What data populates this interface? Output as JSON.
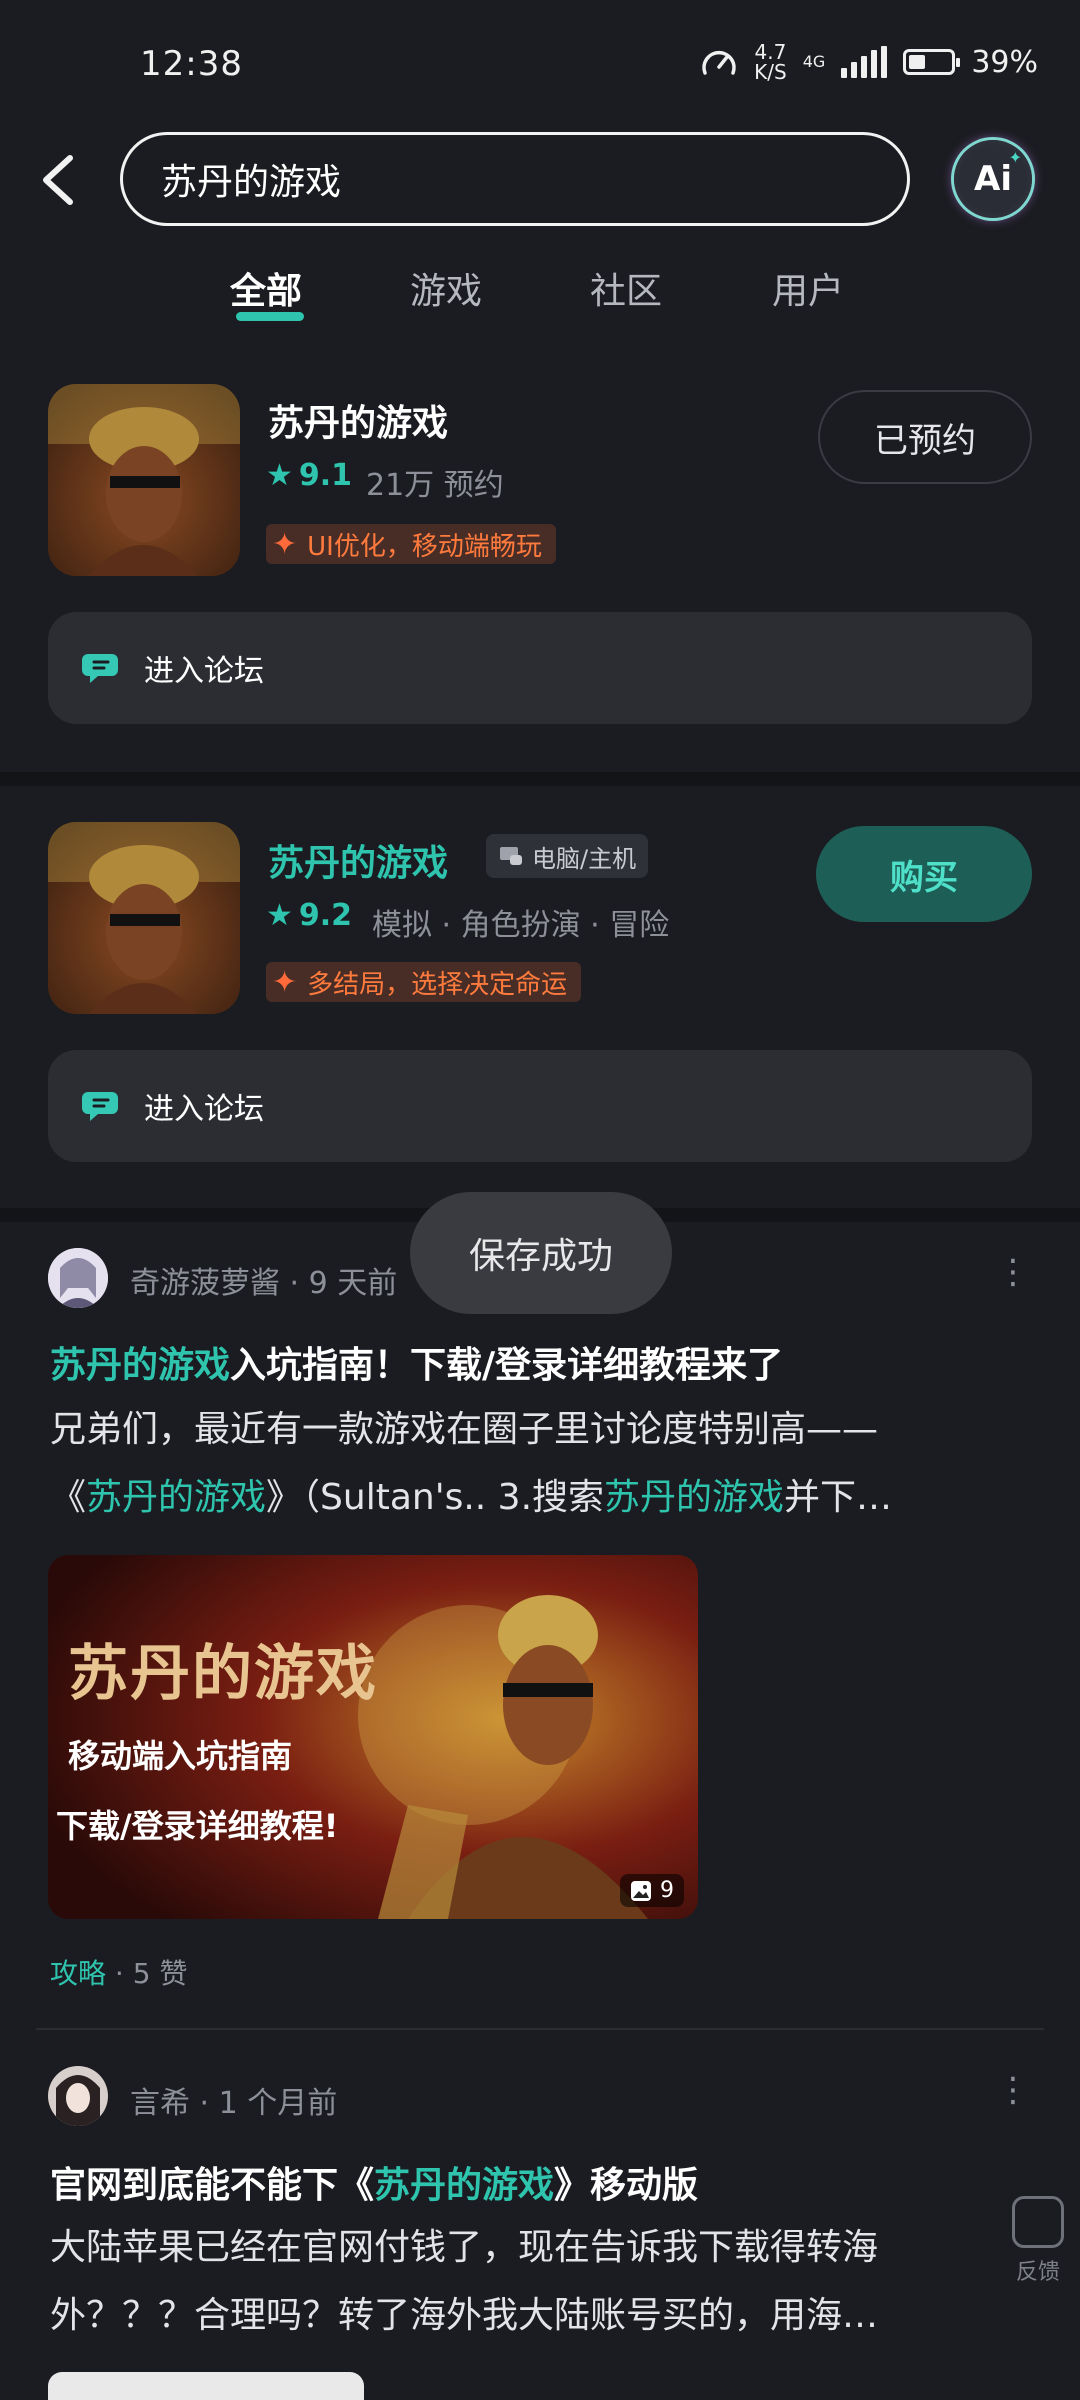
{
  "status_bar": {
    "time": "12:38",
    "speed_value": "4.7",
    "speed_unit": "K/S",
    "network": "4G",
    "battery": "39%",
    "battery_level": 0.39
  },
  "header": {
    "search_value": "苏丹的游戏",
    "ai_label": "Ai"
  },
  "tabs": [
    {
      "label": "全部",
      "active": true
    },
    {
      "label": "游戏",
      "active": false
    },
    {
      "label": "社区",
      "active": false
    },
    {
      "label": "用户",
      "active": false
    }
  ],
  "games": [
    {
      "title": "苏丹的游戏",
      "rating": "9.1",
      "meta": "21万 预约",
      "tagline": "UI优化，移动端畅玩",
      "action": "已预约",
      "forum": "进入论坛"
    },
    {
      "title": "苏丹的游戏",
      "platform": "电脑/主机",
      "rating": "9.2",
      "meta": "模拟 · 角色扮演 · 冒险",
      "tagline": "多结局，选择决定命运",
      "action": "购买",
      "forum": "进入论坛"
    }
  ],
  "toast": "保存成功",
  "posts": [
    {
      "author": "奇游菠萝酱 · 9 天前",
      "title_highlight": "苏丹的游戏",
      "title_rest": "入坑指南！下载/登录详细教程来了",
      "body_line1": "兄弟们，最近有一款游戏在圈子里讨论度特别高——",
      "body_line2_a": "《",
      "body_line2_hl1": "苏丹的游戏",
      "body_line2_b": "》（Sultan's.. 3.搜索",
      "body_line2_hl2": "苏丹的游戏",
      "body_line2_c": "并下…",
      "image_text1": "苏丹的游戏",
      "image_text2": "移动端入坑指南",
      "image_text3": "下载/登录详细教程!",
      "image_count": "9",
      "category": "攻略",
      "likes": "· 5 赞"
    },
    {
      "author": "言希 · 1 个月前",
      "title_a": "官网到底能不能下《",
      "title_highlight": "苏丹的游戏",
      "title_b": "》移动版",
      "body_line1": "大陆苹果已经在官网付钱了，现在告诉我下载得转海",
      "body_line2": "外？？？合理吗？转了海外我大陆账号买的，用海…"
    }
  ],
  "feedback": "反馈"
}
